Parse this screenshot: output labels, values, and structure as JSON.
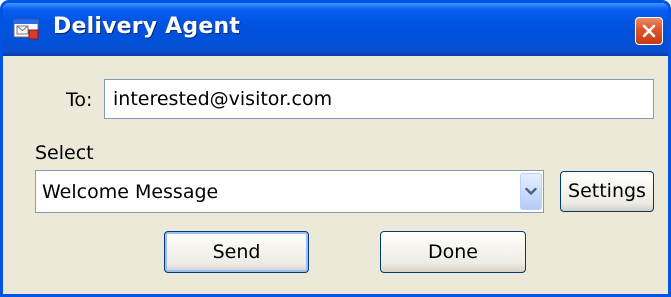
{
  "window": {
    "title": "Delivery Agent"
  },
  "form": {
    "to_label": "To:",
    "to_value": "interested@visitor.com",
    "select_label": "Select",
    "select_value": "Welcome Message"
  },
  "buttons": {
    "settings": "Settings",
    "send": "Send",
    "done": "Done"
  },
  "icons": {
    "app": "mail-window-icon",
    "close": "close-icon",
    "dropdown": "chevron-down-icon"
  },
  "colors": {
    "titlebar": "#0054e3",
    "window_bg": "#ece9d8",
    "close_button": "#e0562d"
  }
}
